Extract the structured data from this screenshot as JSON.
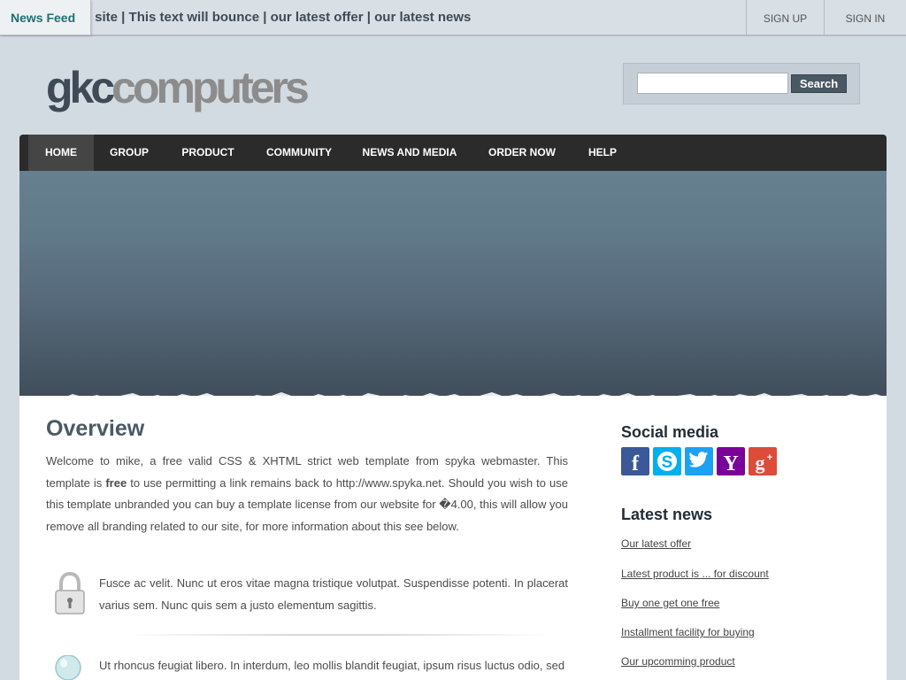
{
  "topbar": {
    "feed_label": "News Feed",
    "ticker": "ur site | This text will bounce | our latest offer | our latest news",
    "sign_up": "SIGN UP",
    "sign_in": "SIGN IN"
  },
  "logo": {
    "part1": "gkc",
    "part2": "computers"
  },
  "search": {
    "button": "Search",
    "value": ""
  },
  "nav": [
    "HOME",
    "GROUP",
    "PRODUCT",
    "COMMUNITY",
    "NEWS AND MEDIA",
    "ORDER NOW",
    "HELP"
  ],
  "overview": {
    "title": "Overview",
    "text_before_free": "Welcome to mike, a free valid CSS & XHTML strict web template from spyka webmaster. This template is ",
    "free": "free",
    "text_after_free": " to use permitting a link remains back to http://www.spyka.net. Should you wish to use this template unbranded you can buy a template license from our website for �4.00, this will allow you remove all branding related to our site, for more information about this see below."
  },
  "features": [
    {
      "icon": "padlock-icon",
      "text": "Fusce ac velit. Nunc ut eros vitae magna tristique volutpat. Suspendisse potenti. In placerat varius sem. Nunc quis sem a justo elementum sagittis."
    },
    {
      "icon": "lightbulb-icon",
      "text": "Ut rhoncus feugiat libero. In interdum, leo mollis blandit feugiat, ipsum risus luctus odio, sed"
    }
  ],
  "social": {
    "title": "Social media",
    "icons": [
      "facebook-icon",
      "skype-icon",
      "twitter-icon",
      "yahoo-icon",
      "google-plus-icon"
    ],
    "colors": [
      "#3b5998",
      "#00aff0",
      "#1da1f2",
      "#7b0099",
      "#dd4b39"
    ]
  },
  "latest_news": {
    "title": "Latest news",
    "items": [
      "Our latest offer",
      "Latest product is ... for discount",
      "Buy one get one free",
      "Installment facility for buying",
      "Our upcomming product"
    ]
  }
}
